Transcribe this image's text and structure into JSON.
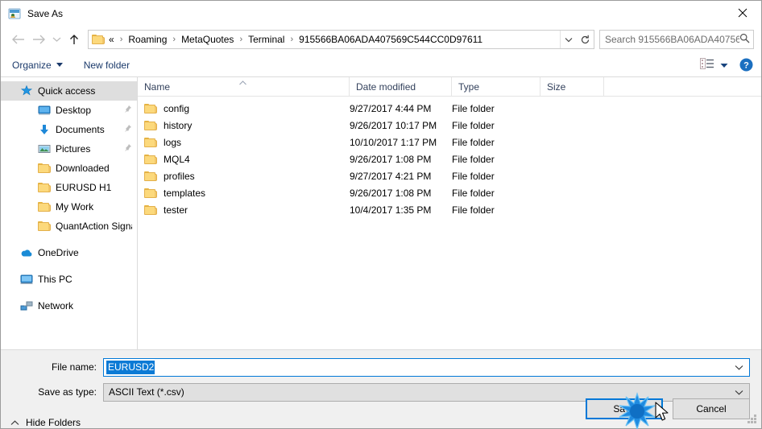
{
  "window": {
    "title": "Save As",
    "icon": "save-as-app-icon",
    "close_label": "✕"
  },
  "nav": {
    "back_icon": "back-arrow-icon",
    "forward_icon": "forward-arrow-icon",
    "recent_icon": "recent-locations-chevron-icon",
    "up_icon": "up-arrow-icon",
    "breadcrumbs": [
      "«",
      "Roaming",
      "MetaQuotes",
      "Terminal",
      "915566BA06ADA407569C544CC0D97611"
    ],
    "dropdown_icon": "address-dropdown-icon",
    "refresh_icon": "refresh-icon"
  },
  "search": {
    "placeholder": "Search 915566BA06ADA40756...",
    "icon": "search-icon"
  },
  "toolbar": {
    "organize_label": "Organize",
    "new_folder_label": "New folder",
    "view_icon": "view-mode-icon",
    "view_caret_icon": "chevron-down-icon",
    "help_label": "?",
    "help_icon": "help-icon"
  },
  "sidebar": {
    "items": [
      {
        "label": "Quick access",
        "icon": "star-icon",
        "level": 0,
        "selected": true,
        "pinned": false
      },
      {
        "label": "Desktop",
        "icon": "desktop-icon",
        "level": 1,
        "selected": false,
        "pinned": true
      },
      {
        "label": "Documents",
        "icon": "download-icon",
        "level": 1,
        "selected": false,
        "pinned": true
      },
      {
        "label": "Pictures",
        "icon": "pictures-icon",
        "level": 1,
        "selected": false,
        "pinned": true
      },
      {
        "label": "Downloaded",
        "icon": "folder-icon",
        "level": 1,
        "selected": false,
        "pinned": false
      },
      {
        "label": "EURUSD H1",
        "icon": "folder-icon",
        "level": 1,
        "selected": false,
        "pinned": false
      },
      {
        "label": "My Work",
        "icon": "folder-icon",
        "level": 1,
        "selected": false,
        "pinned": false
      },
      {
        "label": "QuantAction Signal",
        "icon": "folder-icon",
        "level": 1,
        "selected": false,
        "pinned": false
      },
      {
        "label": "OneDrive",
        "icon": "onedrive-icon",
        "level": 0,
        "selected": false,
        "pinned": false,
        "gap": true
      },
      {
        "label": "This PC",
        "icon": "this-pc-icon",
        "level": 0,
        "selected": false,
        "pinned": false,
        "gap": true
      },
      {
        "label": "Network",
        "icon": "network-icon",
        "level": 0,
        "selected": false,
        "pinned": false,
        "gap": true
      }
    ]
  },
  "filelist": {
    "columns": [
      "Name",
      "Date modified",
      "Type",
      "Size"
    ],
    "sort_column": "Name",
    "sort_direction": "ascending",
    "rows": [
      {
        "name": "config",
        "date": "9/27/2017 4:44 PM",
        "type": "File folder",
        "size": ""
      },
      {
        "name": "history",
        "date": "9/26/2017 10:17 PM",
        "type": "File folder",
        "size": ""
      },
      {
        "name": "logs",
        "date": "10/10/2017 1:17 PM",
        "type": "File folder",
        "size": ""
      },
      {
        "name": "MQL4",
        "date": "9/26/2017 1:08 PM",
        "type": "File folder",
        "size": ""
      },
      {
        "name": "profiles",
        "date": "9/27/2017 4:21 PM",
        "type": "File folder",
        "size": ""
      },
      {
        "name": "templates",
        "date": "9/26/2017 1:08 PM",
        "type": "File folder",
        "size": ""
      },
      {
        "name": "tester",
        "date": "10/4/2017 1:35 PM",
        "type": "File folder",
        "size": ""
      }
    ]
  },
  "footer": {
    "filename_label": "File name:",
    "filename_value": "EURUSD2",
    "filetype_label": "Save as type:",
    "filetype_value": "ASCII Text (*.csv)",
    "hide_folders_label": "Hide Folders",
    "hide_folders_icon": "chevron-up-icon",
    "save_label": "Save",
    "cancel_label": "Cancel",
    "resize_grip_icon": "resize-grip-icon"
  },
  "pointer": {
    "cursor_icon": "mouse-cursor-icon",
    "click_effect_icon": "click-burst-icon"
  },
  "colors": {
    "accent": "#0078d7",
    "selection": "#0b7ad5",
    "folder": "#fcd97c",
    "window_bg": "#f0f0f0"
  }
}
